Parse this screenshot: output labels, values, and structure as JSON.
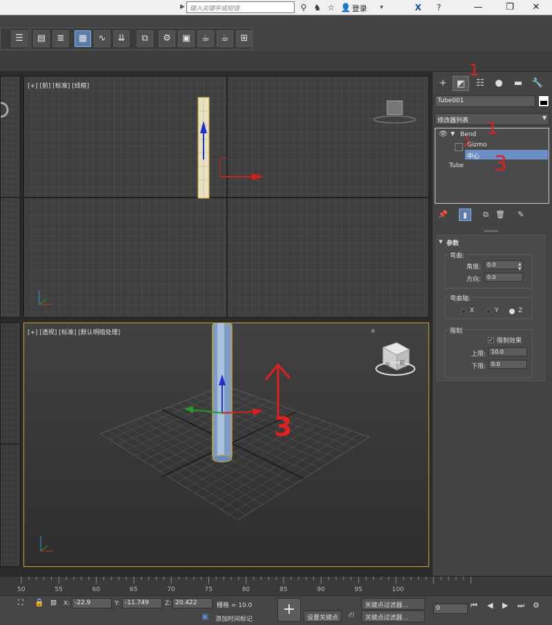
{
  "titlebar": {
    "search_placeholder": "键入关键字或短语",
    "login_label": "登录",
    "minimize": "—",
    "restore": "❐",
    "close": "✕",
    "icons": [
      "binoculars-icon",
      "favorites-icon",
      "star-icon",
      "user-icon",
      "exchange-icon",
      "help-icon"
    ]
  },
  "viewports": {
    "front_label": "[+] [前] [标准] [线框]",
    "persp_label": "[+] [透视] [标准] [默认明暗处理]",
    "viewcube_front": "前",
    "viewcube_left": "左",
    "axis_z": "z"
  },
  "command_panel": {
    "object_name": "Tube001",
    "modifier_list": "修改器列表",
    "stack": {
      "bend": "Bend",
      "gizmo": "Gizmo",
      "center": "中心",
      "tube": "Tube"
    },
    "params": {
      "title": "参数",
      "bend_group": "弯曲:",
      "angle_label": "角度:",
      "angle_value": "0.0",
      "direction_label": "方向:",
      "direction_value": "0.0",
      "axis_group": "弯曲轴:",
      "axis_x": "X",
      "axis_y": "Y",
      "axis_z": "Z",
      "limits_group": "限制",
      "limit_effect": "限制效果",
      "upper_label": "上限:",
      "upper_value": "10.0",
      "lower_label": "下限:",
      "lower_value": "0.0"
    }
  },
  "timeline": {
    "ticks": [
      "50",
      "55",
      "60",
      "65",
      "70",
      "75",
      "80",
      "85",
      "90",
      "95",
      "100"
    ]
  },
  "statusbar": {
    "x_label": "X:",
    "x_value": "-22.9",
    "y_label": "Y:",
    "y_value": "-11.749",
    "z_label": "Z:",
    "z_value": "20.422",
    "grid_label": "栅格 = 10.0",
    "add_time_tag": "添加时间标记",
    "set_key": "设置关键点",
    "key_filter": "关键点过滤器...",
    "key_filter2": "关键点过滤器...",
    "frame_value": "0"
  },
  "annotations": {
    "a1": "1",
    "a2": "2",
    "a3": "3",
    "a_top": "1",
    "a_persp": "3"
  }
}
